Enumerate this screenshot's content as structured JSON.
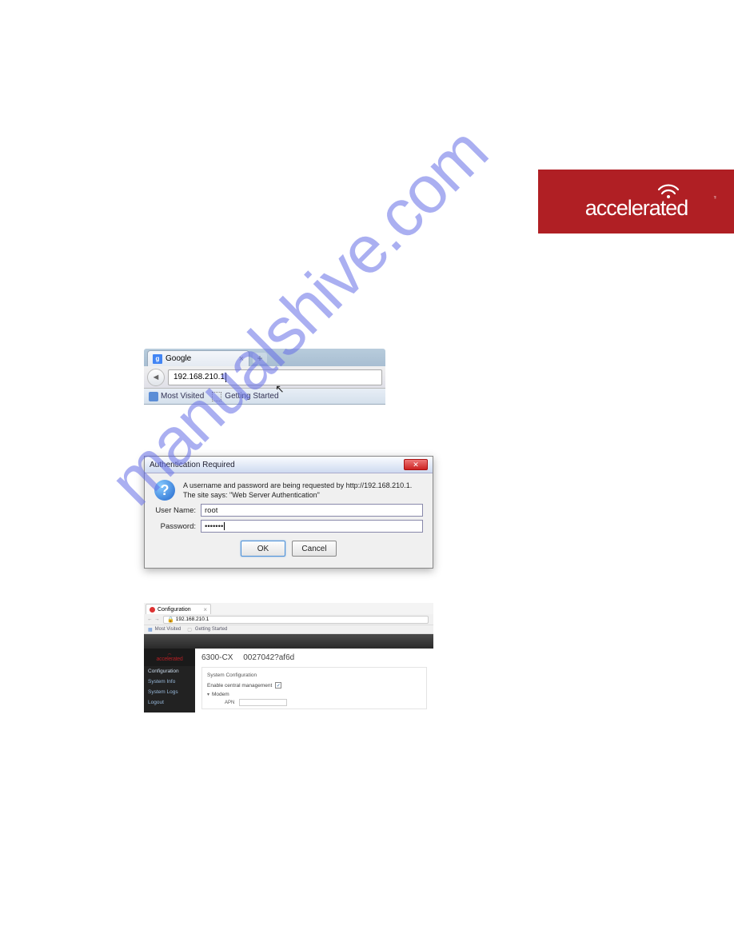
{
  "brand": {
    "name": "accelerated",
    "tm": "™"
  },
  "watermark": "manualshive.com",
  "browser1": {
    "tab_title": "Google",
    "tab_glyph": "g",
    "new_tab_glyph": "+",
    "url": "192.168.210.1",
    "bookmarks": {
      "most_visited": "Most Visited",
      "getting_started": "Getting Started"
    }
  },
  "dialog": {
    "title": "Authentication Required",
    "message": "A username and password are being requested by http://192.168.210.1. The site says: \"Web Server Authentication\"",
    "username_label": "User Name:",
    "username_value": "root",
    "password_label": "Password:",
    "password_value": "•••••••",
    "ok": "OK",
    "cancel": "Cancel",
    "close_glyph": "✕"
  },
  "admin": {
    "tab_title": "Configuration",
    "url": "192.168.210.1",
    "bookmarks": {
      "most_visited": "Most Visited",
      "getting_started": "Getting Started"
    },
    "sidebar": {
      "brand": "accelerated",
      "items": [
        "Configuration",
        "System Info",
        "System Logs",
        "Logout"
      ]
    },
    "header": {
      "model": "6300-CX",
      "mac": "0027042?af6d"
    },
    "section_title": "System Configuration",
    "central_mgmt_label": "Enable central management",
    "central_mgmt_checked": "✓",
    "modem_label": "Modem",
    "apn_label": "APN"
  }
}
